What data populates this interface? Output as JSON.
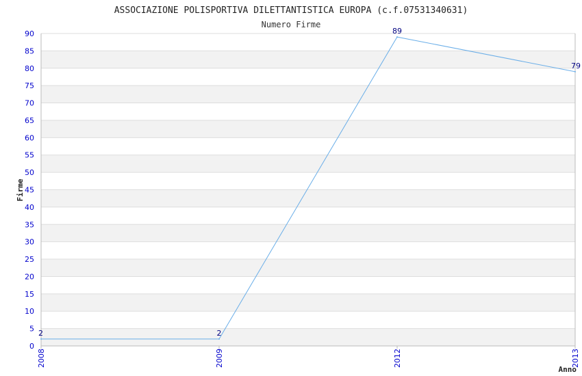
{
  "chart_data": {
    "type": "line",
    "title": "ASSOCIAZIONE POLISPORTIVA DILETTANTISTICA EUROPA (c.f.07531340631)",
    "subtitle": "Numero Firme",
    "xlabel": "Anno",
    "ylabel": "Firme",
    "categories": [
      "2008",
      "2009",
      "2012",
      "2013"
    ],
    "values": [
      2,
      2,
      89,
      79
    ],
    "data_labels": [
      "2",
      "2",
      "89",
      "79"
    ],
    "ylim": [
      0,
      90
    ],
    "y_ticks": [
      0,
      5,
      10,
      15,
      20,
      25,
      30,
      35,
      40,
      45,
      50,
      55,
      60,
      65,
      70,
      75,
      80,
      85,
      90
    ],
    "grid": true,
    "legend": "none"
  },
  "colors": {
    "line": "#6aaee8",
    "tick_text": "#0000cc",
    "data_label": "#000080",
    "band_light": "#f2f2f2",
    "band_white": "#ffffff",
    "gridline": "#dddddd",
    "axis": "#bbbbbb"
  }
}
